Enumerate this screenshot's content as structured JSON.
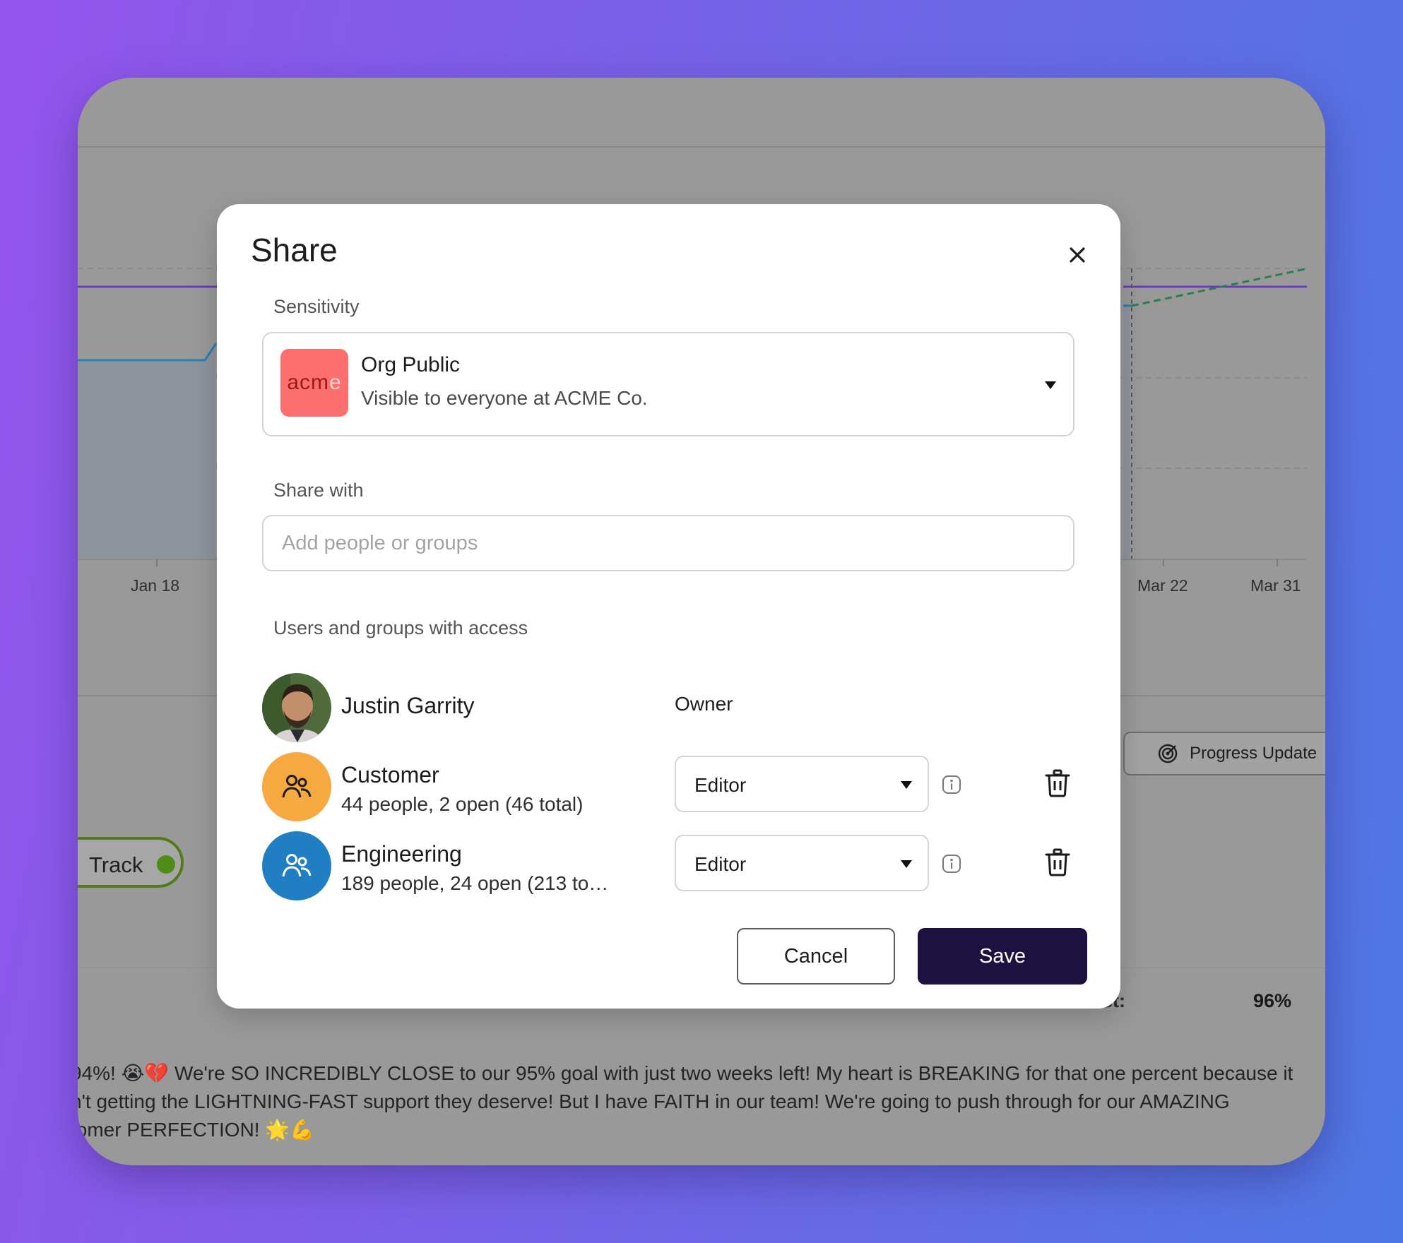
{
  "background": {
    "axis_ticks": [
      "Jan 18",
      "Mar 22",
      "Mar 31"
    ],
    "track_label": "Track",
    "progress_update_label": "Progress Update",
    "forecast_label": "cast:",
    "forecast_value": "96%",
    "update_text_lines": [
      "94%! 😭💔 We're SO INCREDIBLY CLOSE to our 95% goal with just two weeks left! My heart is BREAKING for that one percent because it",
      "n't getting the LIGHTNING-FAST support they deserve! But I have FAITH in our team! We're going to push through for our AMAZING",
      "tomer PERFECTION! 🌟💪"
    ],
    "colors": {
      "target_line": "#6a3cc4",
      "actual_line": "#2a7fb8",
      "forecast_line": "#2e7d4f",
      "on_track": "#4f8d1a"
    }
  },
  "modal": {
    "title": "Share",
    "sensitivity": {
      "label": "Sensitivity",
      "logo_text": "acm",
      "logo_text_faded": "e",
      "logo_color": "#fd6f6f",
      "selected_title": "Org Public",
      "selected_description": "Visible to everyone at ACME Co."
    },
    "share_with": {
      "label": "Share with",
      "placeholder": "Add people or groups"
    },
    "access": {
      "label": "Users and groups with access",
      "entries": [
        {
          "name": "Justin Garrity",
          "subtitle": "",
          "role": "Owner",
          "type": "user"
        },
        {
          "name": "Customer",
          "subtitle": "44 people, 2 open (46 total)",
          "role": "Editor",
          "type": "group",
          "color": "#f5a940"
        },
        {
          "name": "Engineering",
          "subtitle": "189 people, 24 open (213 to…",
          "role": "Editor",
          "type": "group",
          "color": "#1f7fc2"
        }
      ]
    },
    "buttons": {
      "cancel": "Cancel",
      "save": "Save",
      "save_color": "#1d1140"
    }
  }
}
